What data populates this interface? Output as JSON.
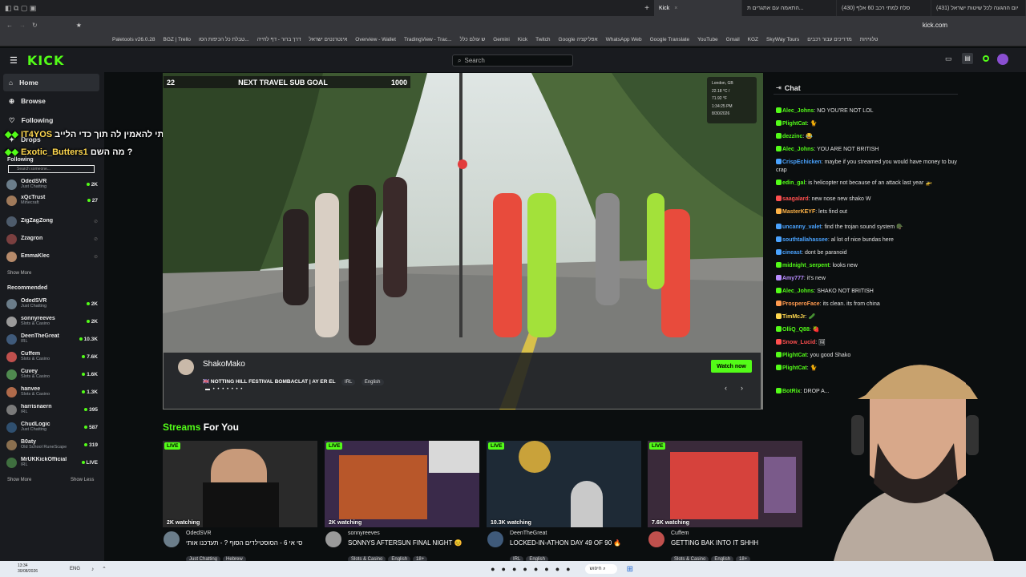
{
  "browser": {
    "tabs": [
      {
        "label": "Kick",
        "active": true
      },
      {
        "label": "התאמה עם אתגרים ת...",
        "active": false
      },
      {
        "label": "(430) סלח למתי רכב 60 אלף",
        "active": false
      },
      {
        "label": "(431) יום ההגעה לכל שיטות ישראל",
        "active": false
      }
    ],
    "url": "kick.com",
    "bookmarks": [
      "Paletools v26.0.28",
      "BGZ | Trello",
      "טבלת כל הכיפות הסו...",
      "דרך ברור - דף לחייה",
      "אינטרנטים ישראל",
      "Overview - Wallet",
      "TradingView - Trac...",
      "ש עולם כלל",
      "Gemini",
      "Kick",
      "Twitch",
      "Google אפליקציה",
      "WhatsApp Web",
      "Google Translate",
      "YouTube",
      "Gmail",
      "KGZ",
      "SkyWay Tours",
      "מדריכים עבור רכבים"
    ],
    "bookmark_right": "טלוויזיות"
  },
  "header": {
    "logo": "KICK",
    "search_placeholder": "Search"
  },
  "sidebar": {
    "nav": [
      {
        "label": "Home",
        "icon": "home-icon",
        "active": true
      },
      {
        "label": "Browse",
        "icon": "browse-icon",
        "active": false
      },
      {
        "label": "Following",
        "icon": "heart-icon",
        "active": false
      },
      {
        "label": "Drops",
        "icon": "gift-icon",
        "active": false
      }
    ],
    "following_heading": "Following",
    "following_search_placeholder": "Search someone...",
    "following": [
      {
        "name": "OdedSVR",
        "category": "Just Chatting",
        "count": "2K",
        "live": true
      },
      {
        "name": "xQcTrust",
        "category": "Minecraft",
        "count": "27",
        "live": true
      },
      {
        "name": "ZigZagZong",
        "category": "",
        "count": "",
        "live": false
      },
      {
        "name": "Zzagron",
        "category": "",
        "count": "",
        "live": false
      },
      {
        "name": "EmmaKlec",
        "category": "",
        "count": "",
        "live": false
      }
    ],
    "show_more_1": "Show More",
    "recommended_heading": "Recommended",
    "recommended": [
      {
        "name": "OdedSVR",
        "category": "Just Chatting",
        "count": "2K"
      },
      {
        "name": "sonnyreeves",
        "category": "Slots & Casino",
        "count": "2K"
      },
      {
        "name": "DeenTheGreat",
        "category": "IRL",
        "count": "10.3K"
      },
      {
        "name": "Cuffem",
        "category": "Slots & Casino",
        "count": "7.6K"
      },
      {
        "name": "Cuvey",
        "category": "Slots & Casino",
        "count": "1.6K"
      },
      {
        "name": "hanvee",
        "category": "Slots & Casino",
        "count": "1.3K"
      },
      {
        "name": "harrisnaern",
        "category": "IRL",
        "count": "395"
      },
      {
        "name": "ChudLogic",
        "category": "Just Chatting",
        "count": "587"
      },
      {
        "name": "B0aty",
        "category": "Old School RuneScape",
        "count": "319"
      },
      {
        "name": "MrUKKickOfficial",
        "category": "IRL",
        "count": "LIVE"
      }
    ],
    "show_more_2": "Show More",
    "show_less": "Show Less"
  },
  "overlay_chat": [
    {
      "user": "IT4YOS",
      "text": "אני הצלחתי להאמין לה תוך כדי הלייב :"
    },
    {
      "user": "Exotic_Butters1",
      "text": "מה השם ?"
    }
  ],
  "player": {
    "subgoal_left": "22",
    "subgoal_title": "NEXT TRAVEL SUB GOAL",
    "subgoal_target": "1000",
    "weather": {
      "city": "London, GB",
      "temp": "22.18 °C /",
      "temp_f": "71.92 °F",
      "time": "1:34:25 PM",
      "date": "8/30/2026"
    },
    "promo": {
      "streamer": "ShakoMako",
      "title": "🇬🇧 NOTTING HILL FESTIVAL BOMBACLAT | AY ER EL",
      "tags": [
        "IRL",
        "English"
      ],
      "watch_label": "Watch now"
    }
  },
  "chat": {
    "title": "Chat",
    "messages": [
      {
        "user": "Alec_Johns",
        "color": "#53fc18",
        "text": "NO YOU'RE NOT LOL"
      },
      {
        "user": "PlightCat",
        "color": "#53fc18",
        "text": "🐈"
      },
      {
        "user": "dezzinc",
        "color": "#53fc18",
        "text": "😂"
      },
      {
        "user": "Alec_Johns",
        "color": "#53fc18",
        "text": "YOU ARE NOT BRITISH"
      },
      {
        "user": "CrispEchicken",
        "color": "#4aa3ff",
        "text": "maybe if you streamed you would have money to buy crap"
      },
      {
        "user": "edin_gal",
        "color": "#53fc18",
        "text": "is helicopter not because of an attack last year 🚁"
      },
      {
        "user": "saagalard",
        "color": "#ff4f4f",
        "text": "new nose new shako W"
      },
      {
        "user": "MasterKEYF",
        "color": "#ffb347",
        "text": "lets find out"
      },
      {
        "user": "uncanny_valet",
        "color": "#4aa3ff",
        "text": "find the trojan sound system 🪖"
      },
      {
        "user": "southtallahassee",
        "color": "#4aa3ff",
        "text": "al lot of nice bundas here"
      },
      {
        "user": "cineast",
        "color": "#4aa3ff",
        "text": "dont be paranoid"
      },
      {
        "user": "midnight_serpent",
        "color": "#53fc18",
        "text": "looks new"
      },
      {
        "user": "Amy777",
        "color": "#b98cff",
        "text": "it's new"
      },
      {
        "user": "Alec_Johns",
        "color": "#53fc18",
        "text": "SHAKO NOT BRITISH"
      },
      {
        "user": "ProsperoFace",
        "color": "#ff9a4f",
        "text": "its clean. its from china"
      },
      {
        "user": "TimMcJr",
        "color": "#ffd84f",
        "text": "🥒"
      },
      {
        "user": "OlliQ_Q88",
        "color": "#53fc18",
        "text": "🍓"
      },
      {
        "user": "Snow_Lucid",
        "color": "#ff4f4f",
        "text": "🖼"
      },
      {
        "user": "PlightCat",
        "color": "#53fc18",
        "text": "you good Shako"
      },
      {
        "user": "PlightCat",
        "color": "#53fc18",
        "text": "🐈"
      },
      {
        "user": "BotRix",
        "color": "#53fc18",
        "text": "DROP A..."
      }
    ]
  },
  "streams": {
    "title_green": "Streams",
    "title_white": " For You",
    "cards": [
      {
        "watching": "2K watching",
        "streamer": "OdedSVR",
        "title": "סי אי 6 - הסוסטילדים הסוף ? - תעדכנו אותי",
        "tags": [
          "Just Chatting",
          "Hebrew"
        ]
      },
      {
        "watching": "2K watching",
        "streamer": "sonnyreeves",
        "title": "SONNYS AFTERSUN FINAL NIGHT 😊",
        "tags": [
          "Slots & Casino",
          "English",
          "18+"
        ]
      },
      {
        "watching": "10.3K watching",
        "streamer": "DeenTheGreat",
        "title": "LOCKED-IN-ATHON DAY 49 OF 90 🔥",
        "tags": [
          "IRL",
          "English"
        ]
      },
      {
        "watching": "7.6K watching",
        "streamer": "Cuffem",
        "title": "GETTING BAK INTO IT SHHH",
        "tags": [
          "Slots & Casino",
          "English",
          "18+"
        ]
      }
    ]
  },
  "taskbar": {
    "time": "13:34",
    "date": "30/08/2026",
    "lang": "ENG",
    "search": "חיפוש"
  },
  "colors": {
    "accent": "#53fc18",
    "background": "#0b0e0f",
    "panel": "#191b1f"
  }
}
